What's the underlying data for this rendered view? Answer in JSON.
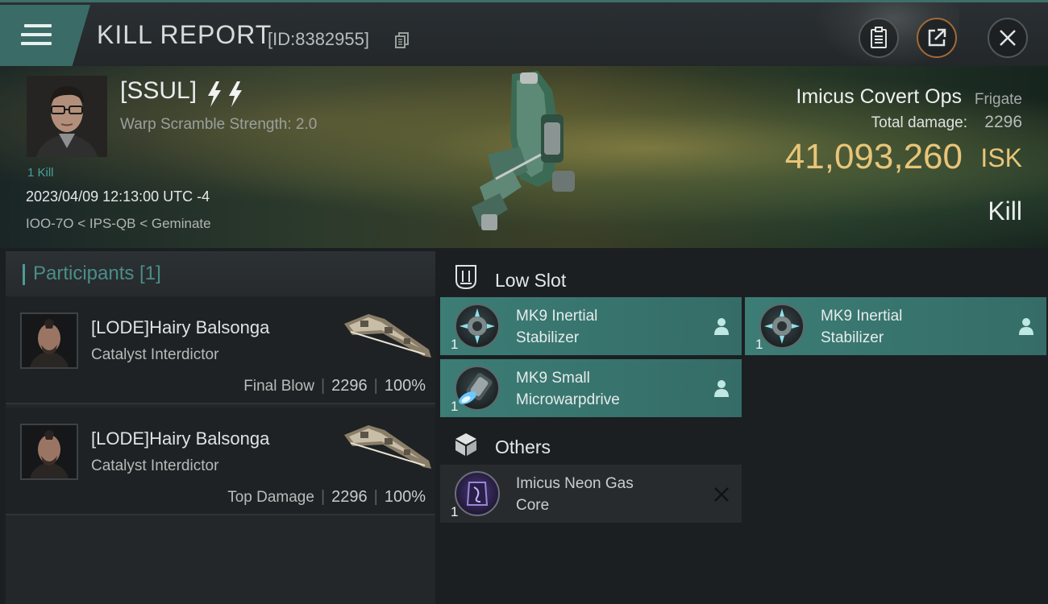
{
  "header": {
    "title": "KILL REPORT",
    "report_id": "[ID:8382955]"
  },
  "victim": {
    "corp": "[SSUL]",
    "warp_scramble": "Warp Scramble Strength: 2.0",
    "kills": "1 Kill",
    "datetime": "2023/04/09 12:13:00 UTC -4",
    "location": "IOO-7O < IPS-QB < Geminate",
    "ship_name": "Imicus Covert Ops",
    "ship_class": "Frigate",
    "total_damage_label": "Total damage:",
    "total_damage": "2296",
    "isk_value": "41,093,260",
    "isk_unit": "ISK",
    "result": "Kill"
  },
  "participants": {
    "header": "Participants [1]",
    "rows": [
      {
        "name": "[LODE]Hairy Balsonga",
        "ship": "Catalyst Interdictor",
        "role": "Final Blow",
        "damage": "2296",
        "percent": "100%"
      },
      {
        "name": "[LODE]Hairy Balsonga",
        "ship": "Catalyst Interdictor",
        "role": "Top Damage",
        "damage": "2296",
        "percent": "100%"
      }
    ]
  },
  "fittings": {
    "low_slot_label": "Low Slot",
    "others_label": "Others",
    "low_slot": [
      {
        "name_line1": "MK9 Inertial",
        "name_line2": "Stabilizer",
        "qty": "1"
      },
      {
        "name_line1": "MK9 Inertial",
        "name_line2": "Stabilizer",
        "qty": "1"
      },
      {
        "name_line1": "MK9 Small",
        "name_line2": "Microwarpdrive",
        "qty": "1"
      }
    ],
    "others": [
      {
        "name_line1": "Imicus Neon Gas",
        "name_line2": "Core",
        "qty": "1"
      }
    ]
  },
  "colors": {
    "accent": "#3c7d76",
    "isk": "#e8c579",
    "participant_header": "#4a8e88"
  }
}
